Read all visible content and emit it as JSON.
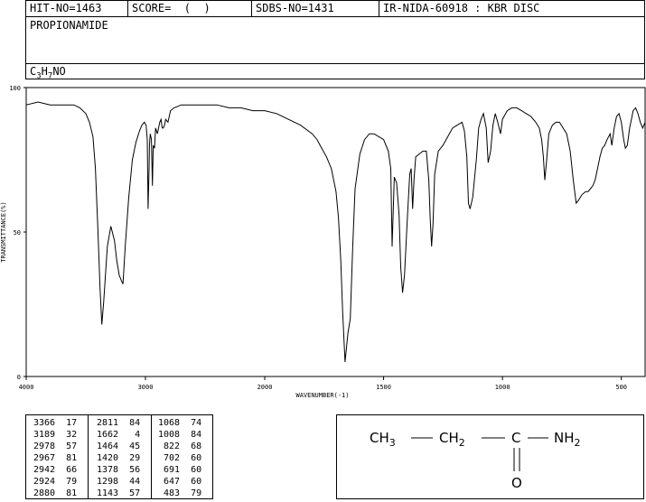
{
  "header": {
    "hit_no": "HIT-NO=1463",
    "score": "SCORE=  (  )",
    "sdbs_no": "SDBS-NO=1431",
    "ir_info": "IR-NIDA-60918 : KBR DISC"
  },
  "compound": {
    "name": "PROPIONAMIDE",
    "formula_c": "C",
    "formula_c_sub": "3",
    "formula_h": "H",
    "formula_h_sub": "7",
    "formula_rest": "NO"
  },
  "chart_data": {
    "type": "line",
    "xlabel": "WAVENUMBER(-1)",
    "ylabel": "TRANSMITTANCE(%)",
    "xlim": [
      4000,
      400
    ],
    "ylim": [
      0,
      100
    ],
    "xticks": [
      "4000",
      "3000",
      "2000",
      "1500",
      "1000",
      "500"
    ],
    "yticks": [
      "100",
      "50",
      "0"
    ],
    "series": [
      {
        "x": [
          4000,
          3900,
          3800,
          3700,
          3600,
          3550,
          3500,
          3470,
          3440,
          3420,
          3400,
          3380,
          3366,
          3350,
          3320,
          3290,
          3260,
          3240,
          3220,
          3200,
          3189,
          3170,
          3140,
          3110,
          3080,
          3050,
          3030,
          3010,
          2995,
          2985,
          2978,
          2970,
          2967,
          2960,
          2950,
          2942,
          2935,
          2924,
          2915,
          2900,
          2880,
          2870,
          2860,
          2850,
          2840,
          2830,
          2811,
          2790,
          2760,
          2700,
          2600,
          2500,
          2400,
          2300,
          2200,
          2100,
          2000,
          1950,
          1900,
          1850,
          1800,
          1780,
          1760,
          1740,
          1720,
          1700,
          1690,
          1680,
          1672,
          1662,
          1650,
          1640,
          1630,
          1620,
          1600,
          1580,
          1560,
          1540,
          1520,
          1500,
          1490,
          1480,
          1470,
          1464,
          1455,
          1445,
          1435,
          1428,
          1420,
          1412,
          1400,
          1390,
          1384,
          1378,
          1372,
          1365,
          1350,
          1335,
          1320,
          1310,
          1304,
          1298,
          1292,
          1285,
          1270,
          1250,
          1230,
          1210,
          1190,
          1170,
          1160,
          1150,
          1143,
          1136,
          1125,
          1110,
          1100,
          1090,
          1080,
          1068,
          1060,
          1050,
          1040,
          1030,
          1020,
          1008,
          1000,
          980,
          960,
          940,
          920,
          900,
          880,
          860,
          845,
          835,
          828,
          822,
          815,
          805,
          790,
          775,
          760,
          745,
          730,
          715,
          702,
          690,
          680,
          665,
          650,
          640,
          630,
          620,
          610,
          600,
          590,
          580,
          570,
          560,
          547,
          540,
          530,
          520,
          510,
          500,
          490,
          483,
          475,
          465,
          450,
          440,
          430,
          420,
          410,
          400
        ],
        "y": [
          94,
          95,
          94,
          94,
          94,
          93,
          91,
          88,
          83,
          72,
          52,
          30,
          18,
          26,
          45,
          52,
          47,
          40,
          35,
          33,
          32,
          45,
          62,
          75,
          81,
          85,
          87,
          88,
          87,
          82,
          58,
          72,
          80,
          84,
          82,
          66,
          80,
          79,
          86,
          84,
          88,
          89,
          86,
          86,
          87,
          89,
          88,
          92,
          93,
          94,
          94,
          94,
          94,
          93,
          93,
          92,
          92,
          91,
          89,
          87,
          84,
          82,
          79,
          76,
          72,
          64,
          55,
          40,
          22,
          5,
          15,
          20,
          45,
          65,
          77,
          82,
          84,
          84,
          83,
          82,
          80,
          78,
          72,
          45,
          69,
          67,
          56,
          38,
          29,
          35,
          55,
          70,
          72,
          58,
          68,
          76,
          77,
          78,
          78,
          68,
          55,
          45,
          53,
          70,
          78,
          80,
          83,
          86,
          87,
          88,
          85,
          76,
          60,
          58,
          62,
          75,
          86,
          89,
          91,
          86,
          74,
          78,
          87,
          91,
          88,
          84,
          89,
          92,
          93,
          93,
          92,
          91,
          90,
          88,
          86,
          82,
          76,
          68,
          74,
          84,
          87,
          88,
          88,
          86,
          84,
          78,
          68,
          60,
          61,
          63,
          64,
          64,
          65,
          66,
          68,
          72,
          76,
          79,
          80,
          82,
          84,
          80,
          86,
          90,
          91,
          88,
          82,
          79,
          80,
          86,
          92,
          93,
          91,
          88,
          86,
          88
        ]
      }
    ]
  },
  "peak_table": {
    "col1": [
      "3366  17",
      "3189  32",
      "2978  57",
      "2967  81",
      "2942  66",
      "2924  79",
      "2880  81"
    ],
    "col2": [
      "2811  84",
      "1662   4",
      "1464  45",
      "1420  29",
      "1378  56",
      "1298  44",
      "1143  57"
    ],
    "col3": [
      "1068  74",
      "1008  84",
      " 822  68",
      " 702  60",
      " 691  60",
      " 647  60",
      " 483  79"
    ]
  },
  "structure": {
    "ch3": "CH3",
    "ch2": "CH2",
    "c": "C",
    "nh2": "NH2",
    "o": "O"
  }
}
